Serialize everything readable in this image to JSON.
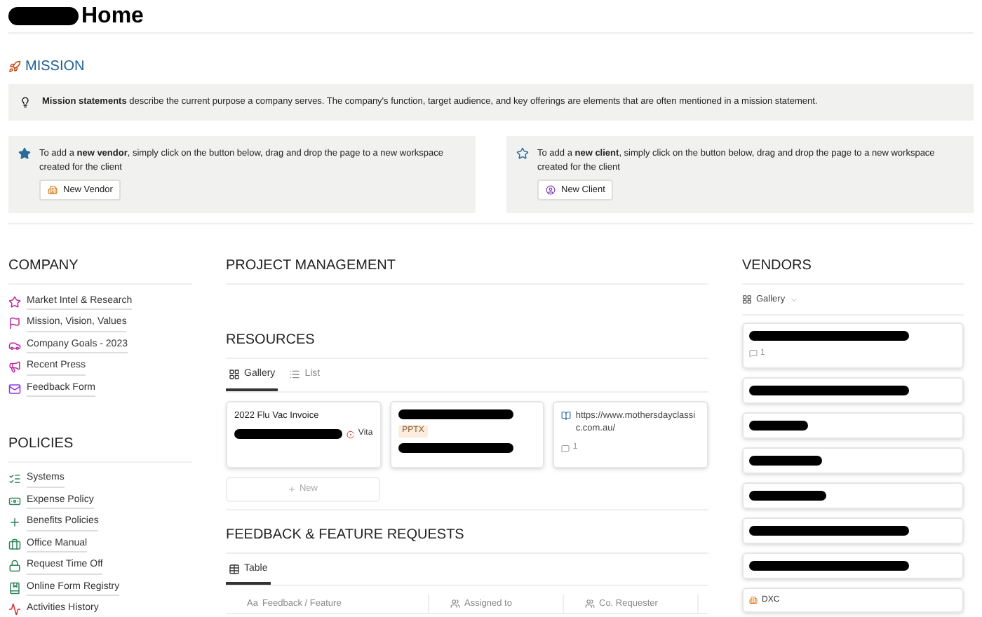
{
  "page": {
    "title": "Home"
  },
  "mission": {
    "heading": "MISSION",
    "callout": "**Mission statements** describe the current purpose a company serves. The company's function, target audience, and key offerings are elements that are often mentioned in a mission statement."
  },
  "add_callouts": [
    {
      "text": "To add a **new vendor**, simply click on the button below, drag and drop the page to a new workspace created for the client",
      "button": "New Vendor",
      "kind": "vendor"
    },
    {
      "text": "To add a **new client**, simply click on the button below, drag and drop the page to a new workspace created for the client",
      "button": "New Client",
      "kind": "client"
    }
  ],
  "company": {
    "heading": "COMPANY",
    "items": [
      "Market Intel & Research",
      "Mission, Vision, Values",
      "Company Goals - 2023",
      "Recent Press",
      "Feedback Form"
    ]
  },
  "policies": {
    "heading": "POLICIES",
    "items": [
      "Systems",
      "Expense Policy",
      "Benefits Policies",
      "Office Manual",
      "Request Time Off",
      "Online Form Registry",
      "Activities History"
    ]
  },
  "project_management": {
    "heading": "PROJECT MANAGEMENT"
  },
  "resources": {
    "heading": "RESOURCES",
    "tabs": [
      {
        "label": "Gallery",
        "selected": true
      },
      {
        "label": "List",
        "selected": false
      }
    ],
    "cards": [
      {
        "kind": "invoice",
        "title": "2022 Flu Vac Invoice",
        "tag": "Vita"
      },
      {
        "kind": "file",
        "tag": "PPTX"
      },
      {
        "kind": "link",
        "title": "https://www.mothersdayclassic.com.au/",
        "comments": "1"
      }
    ],
    "new_button": "New"
  },
  "feedback": {
    "heading": "FEEDBACK & FEATURE REQUESTS",
    "tabs": [
      {
        "label": "Table",
        "selected": true
      }
    ],
    "columns": [
      {
        "icon": "Aa",
        "label": "Feedback / Feature"
      },
      {
        "label": "Assigned to"
      },
      {
        "label": "Co. Requester"
      }
    ]
  },
  "vendors": {
    "heading": "VENDORS",
    "view": "Gallery",
    "cards": [
      {
        "kind": "redacted",
        "comments": "1"
      },
      {
        "kind": "redacted"
      },
      {
        "kind": "redacted"
      },
      {
        "kind": "redacted"
      },
      {
        "kind": "redacted"
      },
      {
        "kind": "redacted"
      },
      {
        "kind": "redacted"
      },
      {
        "kind": "named",
        "title": "DXC"
      }
    ]
  }
}
